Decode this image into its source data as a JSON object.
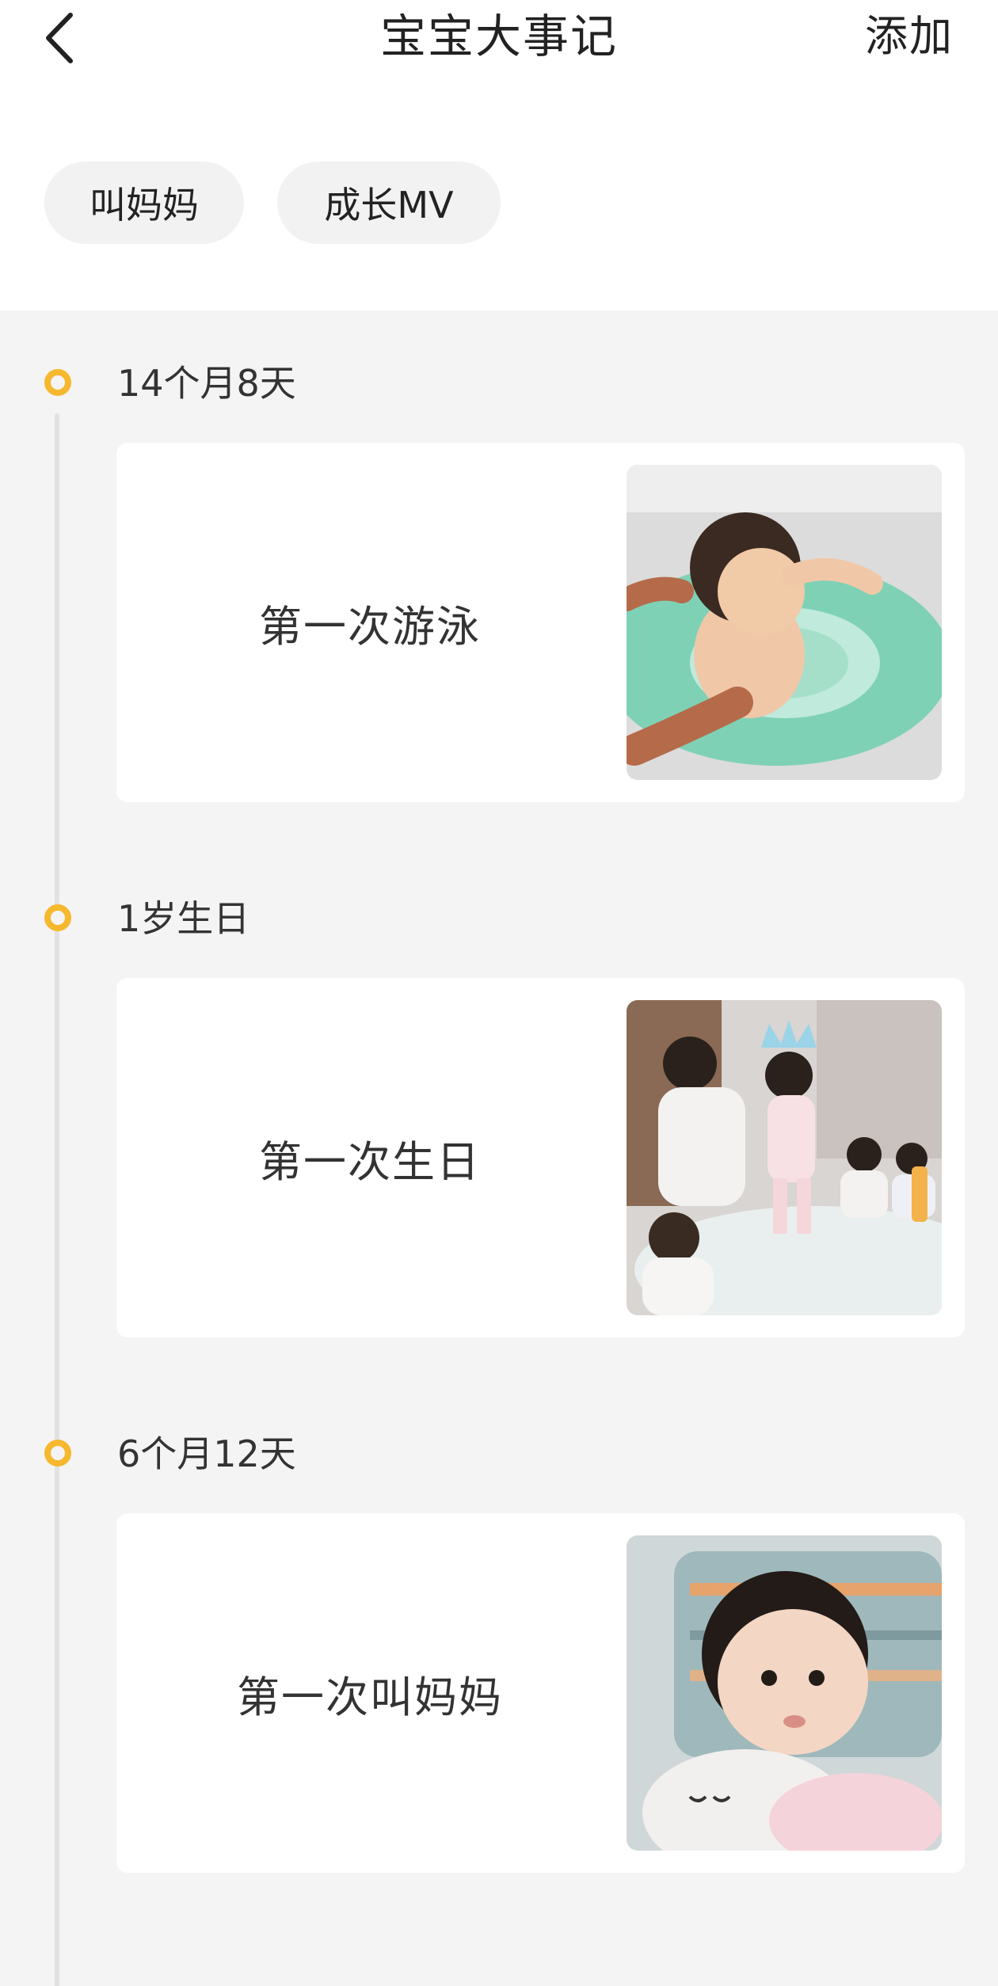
{
  "nav": {
    "title": "宝宝大事记",
    "add_label": "添加"
  },
  "tags": [
    {
      "label": "叫妈妈"
    },
    {
      "label": "成长MV"
    }
  ],
  "events": [
    {
      "age": "14个月8天",
      "title": "第一次游泳",
      "photo_icon": "baby-swimming-photo"
    },
    {
      "age": "1岁生日",
      "title": "第一次生日",
      "photo_icon": "birthday-party-photo"
    },
    {
      "age": "6个月12天",
      "title": "第一次叫妈妈",
      "photo_icon": "baby-portrait-photo"
    }
  ],
  "colors": {
    "accent": "#f5b82e",
    "background": "#f4f4f4",
    "card": "#ffffff",
    "chip": "#f2f2f2",
    "timeline_line": "#e2e2e2"
  }
}
